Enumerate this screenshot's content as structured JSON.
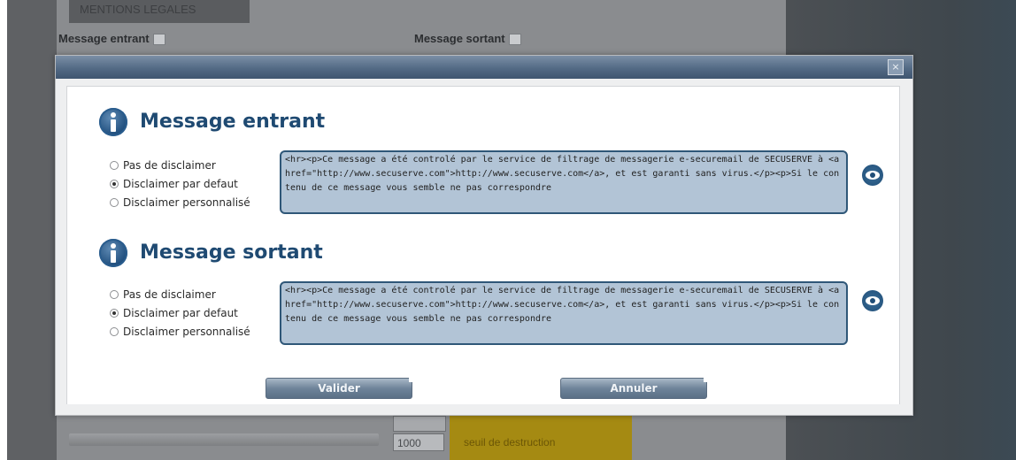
{
  "background": {
    "tab_label": "MENTIONS LEGALES",
    "label_incoming": "Message entrant",
    "label_outgoing": "Message sortant",
    "threshold_value": "1000",
    "threshold_label": "seuil de destruction"
  },
  "dialog": {
    "close_label": "×",
    "sections": [
      {
        "title": "Message entrant",
        "options": [
          "Pas de disclaimer",
          "Disclaimer par defaut",
          "Disclaimer personnalisé"
        ],
        "selected": "Disclaimer par defaut",
        "content": "<hr><p>Ce message a été controlé par le service de filtrage de messagerie e-securemail de SECUSERVE à <a href=\"http://www.secuserve.com\">http://www.secuserve.com</a>, et est garanti sans virus.</p><p>Si le contenu de ce message vous semble ne pas correspondre"
      },
      {
        "title": "Message sortant",
        "options": [
          "Pas de disclaimer",
          "Disclaimer par defaut",
          "Disclaimer personnalisé"
        ],
        "selected": "Disclaimer par defaut",
        "content": "<hr><p>Ce message a été controlé par le service de filtrage de messagerie e-securemail de SECUSERVE à <a href=\"http://www.secuserve.com\">http://www.secuserve.com</a>, et est garanti sans virus.</p><p>Si le contenu de ce message vous semble ne pas correspondre"
      }
    ],
    "validate_label": "Valider",
    "cancel_label": "Annuler"
  },
  "icons": {
    "section": "info-icon",
    "preview": "eye-icon",
    "close": "close-icon"
  },
  "colors": {
    "title_blue": "#1f4a72",
    "textarea_bg": "#b2c4d6",
    "titlebar": "#536a85"
  }
}
